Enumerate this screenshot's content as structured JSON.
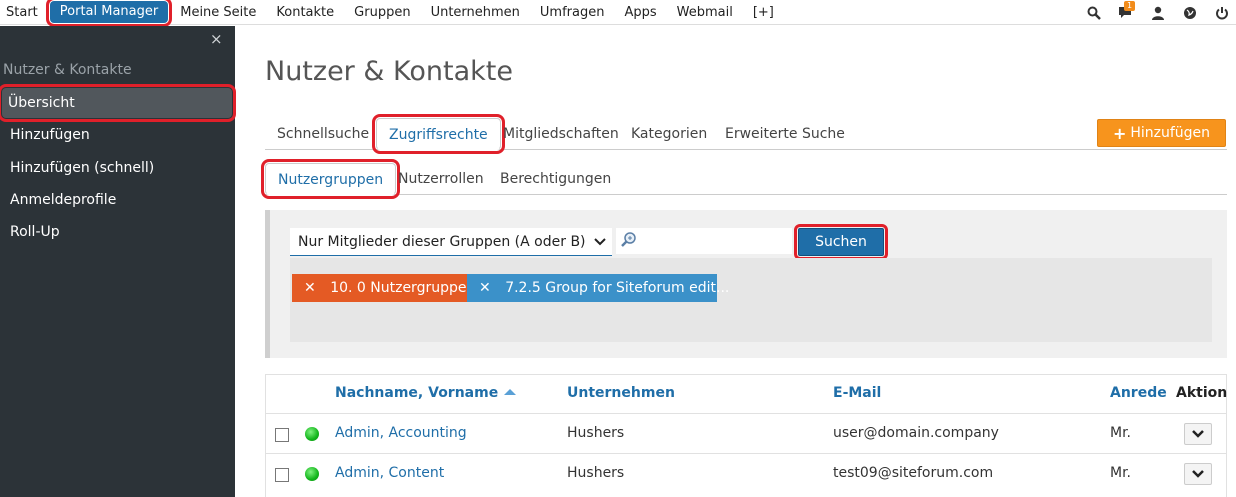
{
  "topnav": {
    "items": [
      "Start",
      "Portal Manager",
      "Meine Seite",
      "Kontakte",
      "Gruppen",
      "Unternehmen",
      "Umfragen",
      "Apps",
      "Webmail",
      "[+]"
    ],
    "active_index": 1,
    "notification_count": "1",
    "icons": [
      "search-icon",
      "chat-icon",
      "user-icon",
      "globe-icon",
      "power-icon"
    ]
  },
  "sidebar": {
    "close": "×",
    "section": "Nutzer & Kontakte",
    "items": [
      "Übersicht",
      "Hinzufügen",
      "Hinzufügen (schnell)",
      "Anmeldeprofile",
      "Roll-Up"
    ],
    "active_index": 0
  },
  "page": {
    "title": "Nutzer & Kontakte",
    "tabs": [
      "Schnellsuche",
      "Zugriffsrechte",
      "Mitgliedschaften",
      "Kategorien",
      "Erweiterte Suche"
    ],
    "active_tab": 1,
    "subtabs": [
      "Nutzergruppen",
      "Nutzerrollen",
      "Berechtigungen"
    ],
    "active_subtab": 0,
    "add_button": "Hinzufügen"
  },
  "filter": {
    "select_value": "Nur Mitglieder dieser Gruppen (A oder B)",
    "search_value": "",
    "search_button": "Suchen",
    "tags": [
      "10. 0 Nutzergruppe",
      "7.2.5 Group for Siteforum edit..."
    ],
    "tag_remove": "✕"
  },
  "table": {
    "headers": {
      "name": "Nachname, Vorname",
      "company": "Unternehmen",
      "email": "E-Mail",
      "salutation": "Anrede",
      "action": "Aktion"
    },
    "rows": [
      {
        "name": "Admin, Accounting",
        "company": "Hushers",
        "email": "user@domain.company",
        "salutation": "Mr."
      },
      {
        "name": "Admin, Content",
        "company": "Hushers",
        "email": "test09@siteforum.com",
        "salutation": "Mr."
      }
    ]
  },
  "colors": {
    "accent": "#1f6ea8",
    "orange": "#f7941d",
    "tag_orange": "#e45a24",
    "tag_blue": "#3b91c9",
    "sidebar": "#2c3338",
    "highlight": "#e0202a"
  }
}
